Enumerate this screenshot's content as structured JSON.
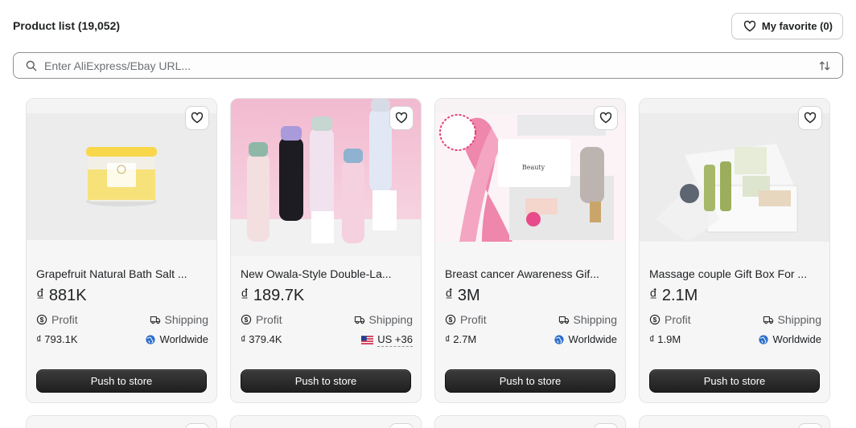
{
  "header": {
    "title": "Product list (19,052)",
    "favorite_label": "My favorite (0)"
  },
  "search": {
    "placeholder": "Enter AliExpress/Ebay URL..."
  },
  "labels": {
    "profit": "Profit",
    "shipping": "Shipping",
    "push": "Push to store"
  },
  "products": [
    {
      "name": "Grapefruit Natural Bath Salt ...",
      "price": "₫ 881K",
      "profit": "₫ 793.1K",
      "ship": "Worldwide"
    },
    {
      "name": "New Owala-Style Double-La...",
      "price": "₫ 189.7K",
      "profit": "₫ 379.4K",
      "ship": "US +36"
    },
    {
      "name": "Breast cancer Awareness Gif...",
      "price": "₫ 3M",
      "profit": "₫ 2.7M",
      "ship": "Worldwide"
    },
    {
      "name": "Massage couple Gift Box For ...",
      "price": "₫ 2.1M",
      "profit": "₫ 1.9M",
      "ship": "Worldwide"
    }
  ],
  "colors": {
    "accent": "#202223",
    "globe": "#2c6ecb"
  }
}
